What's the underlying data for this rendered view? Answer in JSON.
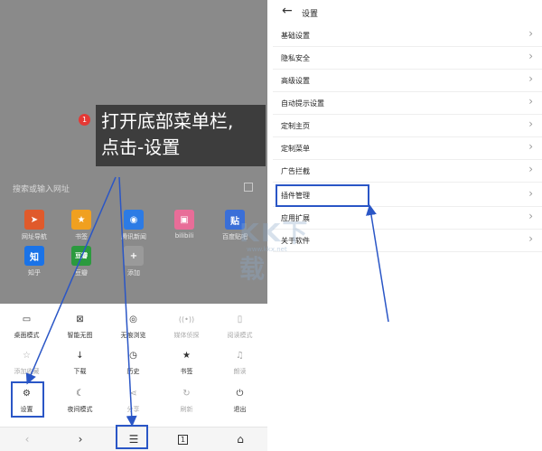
{
  "left": {
    "search_placeholder": "搜索或输入网址",
    "apps": [
      {
        "label": "网址导航",
        "color": "#e05a2b",
        "glyph": "➤"
      },
      {
        "label": "书签",
        "color": "#f0a020",
        "glyph": "★"
      },
      {
        "label": "腾讯新闻",
        "color": "#2c7be5",
        "glyph": "◉"
      },
      {
        "label": "bilibili",
        "color": "#e86d98",
        "glyph": "▣"
      },
      {
        "label": "百度贴吧",
        "color": "#3a6fd8",
        "glyph": "贴"
      },
      {
        "label": "知乎",
        "color": "#1a73e8",
        "glyph": "知"
      },
      {
        "label": "豆瓣",
        "color": "#2b9a3e",
        "glyph": "豆瓣"
      },
      {
        "label": "添加",
        "color": "#9a9a9a",
        "glyph": "+"
      }
    ],
    "callout": {
      "badge": "1",
      "line1": "打开底部菜单栏,",
      "line2": "点击-设置"
    },
    "menu": [
      {
        "label": "桌面模式",
        "icon": "▭",
        "light": false
      },
      {
        "label": "智能无图",
        "icon": "⊠",
        "light": false
      },
      {
        "label": "无痕浏览",
        "icon": "◎",
        "light": false
      },
      {
        "label": "媒体侦探",
        "icon": "((•))",
        "light": true
      },
      {
        "label": "阅读模式",
        "icon": "▯",
        "light": true
      },
      {
        "label": "添加收藏",
        "icon": "☆",
        "light": true
      },
      {
        "label": "下载",
        "icon": "↓",
        "light": false
      },
      {
        "label": "历史",
        "icon": "◷",
        "light": false
      },
      {
        "label": "书签",
        "icon": "★",
        "light": false
      },
      {
        "label": "朗读",
        "icon": "♫",
        "light": true
      },
      {
        "label": "设置",
        "icon": "⚙",
        "light": false
      },
      {
        "label": "夜间模式",
        "icon": "☾",
        "light": false
      },
      {
        "label": "分享",
        "icon": "⋖",
        "light": true
      },
      {
        "label": "刷新",
        "icon": "↻",
        "light": true
      },
      {
        "label": "退出",
        "icon": "⏻",
        "light": false
      }
    ],
    "bottom": {
      "back": "‹",
      "forward": "›",
      "menu": "☰",
      "tabs": "1",
      "home": "⌂"
    }
  },
  "right": {
    "title": "设置",
    "back": "←",
    "rows": [
      {
        "label": "基础设置"
      },
      {
        "label": "隐私安全"
      },
      {
        "label": "高级设置"
      },
      {
        "label": "自动提示设置"
      },
      {
        "label": "定制主页"
      },
      {
        "label": "定制菜单"
      },
      {
        "label": "广告拦截"
      },
      {
        "label": "插件管理"
      },
      {
        "label": "应用扩展"
      },
      {
        "label": "关于软件"
      }
    ],
    "chevron": "›"
  },
  "watermark": {
    "text": "KK下载",
    "url": "www.kkx.net"
  },
  "colors": {
    "highlight": "#2a56c6",
    "badge": "#e53935",
    "dots_active": "#4c8cf5"
  }
}
